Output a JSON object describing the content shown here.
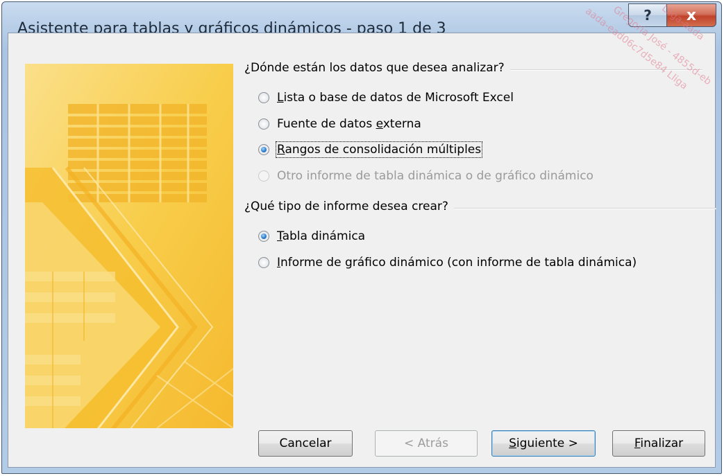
{
  "window": {
    "title": "Asistente para tablas y gráficos dinámicos - paso 1 de 3",
    "help_label": "?",
    "close_label": "x"
  },
  "source_group": {
    "header": "¿Dónde están los datos que desea analizar?",
    "options": [
      {
        "pre": "",
        "key": "L",
        "post": "ista o base de datos de Microsoft Excel",
        "selected": false,
        "enabled": true
      },
      {
        "pre": "Fuente de datos ",
        "key": "e",
        "post": "xterna",
        "selected": false,
        "enabled": true
      },
      {
        "pre": "",
        "key": "R",
        "post": "angos de consolidación múltiples",
        "selected": true,
        "enabled": true
      },
      {
        "pre": "Otro informe de tabla dinámica o de gráfico dinámico",
        "key": "",
        "post": "",
        "selected": false,
        "enabled": false
      }
    ]
  },
  "report_group": {
    "header": "¿Qué tipo de informe desea crear?",
    "options": [
      {
        "pre": "",
        "key": "T",
        "post": "abla dinámica",
        "selected": true,
        "enabled": true
      },
      {
        "pre": "",
        "key": "I",
        "post": "nforme de gráfico dinámico (con informe de tabla dinámica)",
        "selected": false,
        "enabled": true
      }
    ]
  },
  "buttons": {
    "cancel": "Cancelar",
    "back": "< Atrás",
    "next_key": "S",
    "next_rest": "iguiente >",
    "finish_key": "F",
    "finish_rest": "inalizar"
  },
  "watermark": [
    "Gregoria José - 4855d-eb",
    "aada-ead06c7d5e84 Lliga",
    "Lliga-aada"
  ],
  "colors": {
    "title_bar": "#b2cbe6",
    "close_button": "#c0432a",
    "art_yellow": "#f7c63c",
    "radio_selected": "#2d7fd0"
  }
}
